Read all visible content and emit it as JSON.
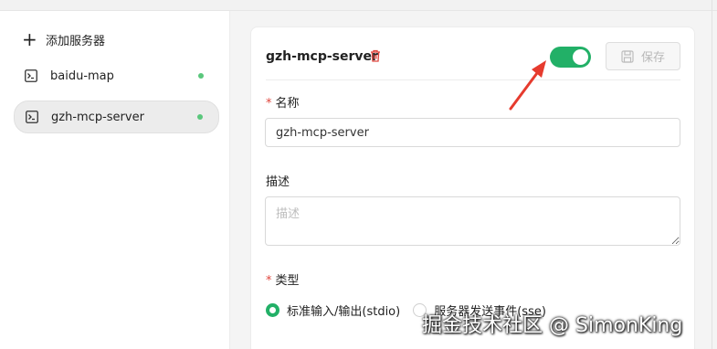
{
  "sidebar": {
    "add_label": "添加服务器",
    "items": [
      {
        "label": "baidu-map",
        "status": "running",
        "active": false
      },
      {
        "label": "gzh-mcp-server",
        "status": "running",
        "active": true
      }
    ]
  },
  "form": {
    "title": "gzh-mcp-server",
    "enabled": true,
    "save_label": "保存",
    "name_label": "名称",
    "name_value": "gzh-mcp-server",
    "desc_label": "描述",
    "desc_placeholder": "描述",
    "type_label": "类型",
    "type_options": [
      {
        "label": "标准输入/输出(stdio)",
        "checked": true
      },
      {
        "label": "服务器发送事件(sse)",
        "checked": false
      }
    ]
  },
  "watermark": "掘金技术社区 @ SimonKing",
  "colors": {
    "accent": "#22b067",
    "status_dot": "#5ac77c",
    "required": "#e0463e",
    "delete_icon": "#e0463e",
    "annotation_arrow": "#e63b2e"
  }
}
